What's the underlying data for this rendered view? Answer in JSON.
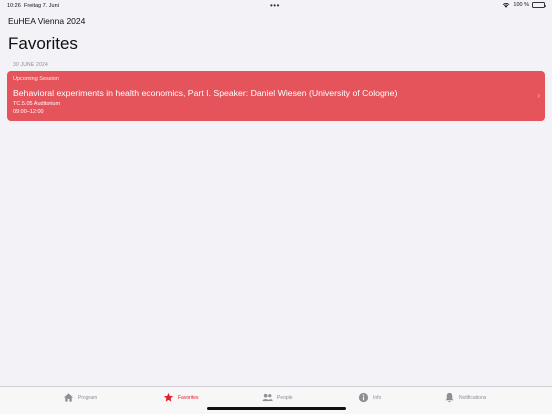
{
  "status_bar": {
    "time": "10:26",
    "date": "Freitag 7. Juni",
    "battery": "100 %"
  },
  "app_title": "EuHEA Vienna 2024",
  "page_title": "Favorites",
  "section_header": "30 JUNE 2024",
  "session": {
    "status": "Upcoming  Session",
    "title": "Behavioral experiments in health economics, Part I.  Speaker: Daniel Wiesen (University of Cologne)",
    "room": "TC.5.05 Auditorium",
    "time": "09:00–12:00",
    "color": "#e5535b"
  },
  "tabs": [
    {
      "label": "Program",
      "icon": "home-icon",
      "active": false
    },
    {
      "label": "Favorites",
      "icon": "star-icon",
      "active": true
    },
    {
      "label": "People",
      "icon": "people-icon",
      "active": false
    },
    {
      "label": "Info",
      "icon": "info-icon",
      "active": false
    },
    {
      "label": "Notifications",
      "icon": "bell-icon",
      "active": false
    }
  ],
  "colors": {
    "accent": "#e0202c",
    "background": "#f2f2f7",
    "inactive_tab": "#8e8e93"
  }
}
